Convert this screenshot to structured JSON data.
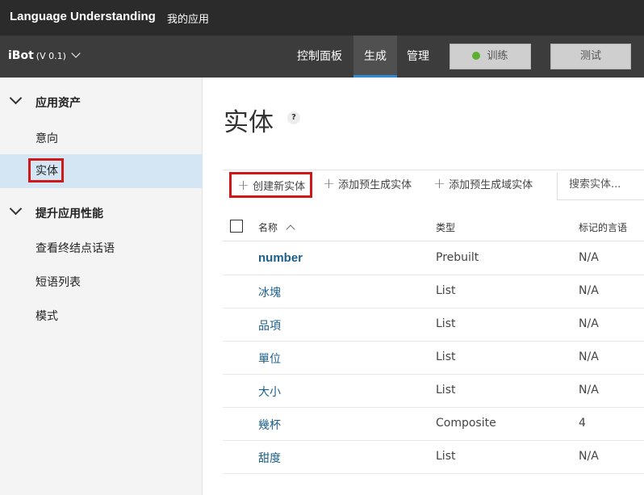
{
  "topbar": {
    "brand": "Language Understanding",
    "my_apps": "我的应用"
  },
  "appbar": {
    "app_name": "iBot",
    "version": "(V 0.1)",
    "tabs": [
      {
        "label": "控制面板",
        "active": false
      },
      {
        "label": "生成",
        "active": true
      },
      {
        "label": "管理",
        "active": false
      }
    ],
    "train_label": "训练",
    "test_label": "测试",
    "train_status_color": "#5cb030"
  },
  "sidebar": {
    "sections": [
      {
        "label": "应用资产",
        "items": [
          "意向",
          "实体"
        ]
      },
      {
        "label": "提升应用性能",
        "items": [
          "查看终结点话语",
          "短语列表",
          "模式"
        ]
      }
    ],
    "selected_item": "实体"
  },
  "main": {
    "title": "实体",
    "help": "?",
    "toolbar": {
      "create": "创建新实体",
      "add_prebuilt": "添加预生成实体",
      "add_prebuilt_domain": "添加预生成域实体",
      "search_placeholder": "搜索实体..."
    },
    "table": {
      "headers": {
        "name": "名称",
        "type": "类型",
        "labeled": "标记的言语"
      },
      "rows": [
        {
          "name": "number",
          "type": "Prebuilt",
          "labeled": "N/A"
        },
        {
          "name": "冰塊",
          "type": "List",
          "labeled": "N/A"
        },
        {
          "name": "品項",
          "type": "List",
          "labeled": "N/A"
        },
        {
          "name": "單位",
          "type": "List",
          "labeled": "N/A"
        },
        {
          "name": "大小",
          "type": "List",
          "labeled": "N/A"
        },
        {
          "name": "幾杯",
          "type": "Composite",
          "labeled": "4"
        },
        {
          "name": "甜度",
          "type": "List",
          "labeled": "N/A"
        }
      ]
    }
  },
  "colors": {
    "accent": "#2f8bd6",
    "highlight_box": "#d11818",
    "link": "#1b5f8c"
  }
}
